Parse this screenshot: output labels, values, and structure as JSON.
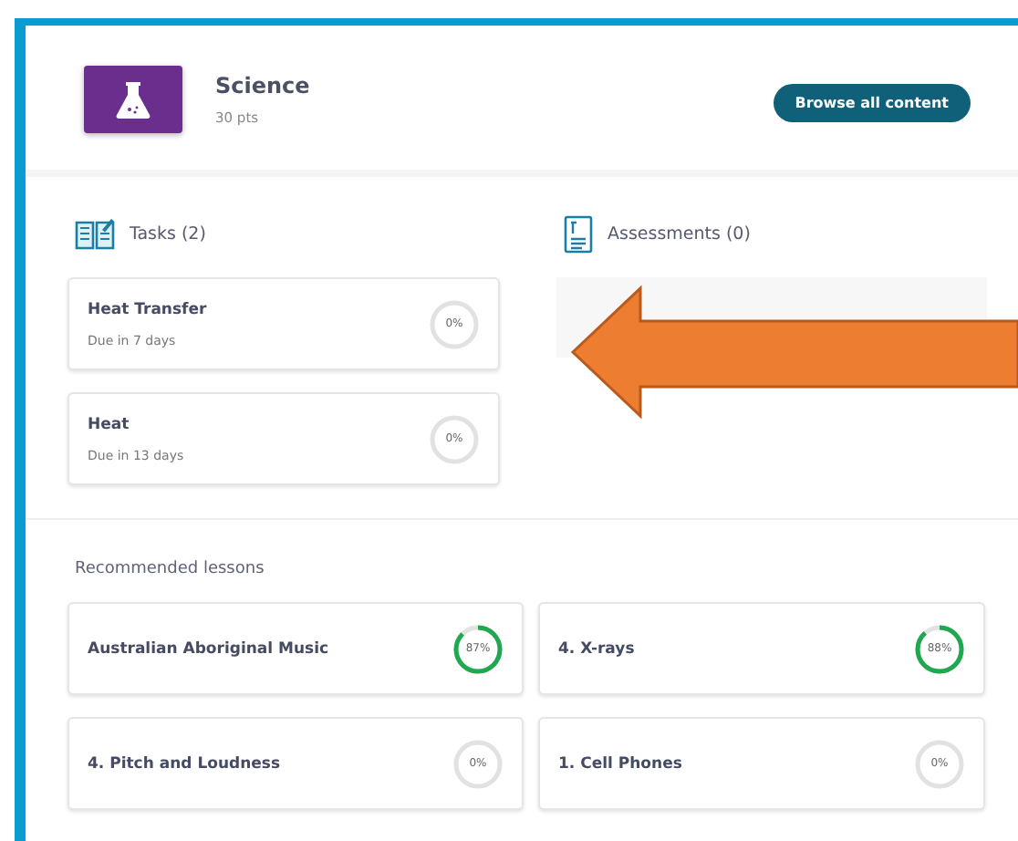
{
  "course": {
    "title": "Science",
    "points": "30 pts"
  },
  "browse_button": "Browse all content",
  "tasks": {
    "heading": "Tasks (2)",
    "items": [
      {
        "title": "Heat Transfer",
        "due": "Due in 7 days",
        "progress": "0%",
        "level": 0
      },
      {
        "title": "Heat",
        "due": "Due in 13 days",
        "progress": "0%",
        "level": 0
      }
    ]
  },
  "assessments": {
    "heading": "Assessments (0)"
  },
  "recommended": {
    "heading": "Recommended lessons",
    "items": [
      {
        "title": "Australian Aboriginal Music",
        "progress": "87%",
        "level": 0.87
      },
      {
        "title": "4. X-rays",
        "progress": "88%",
        "level": 0.88
      },
      {
        "title": "4. Pitch and Loudness",
        "progress": "0%",
        "level": 0
      },
      {
        "title": "1. Cell Phones",
        "progress": "0%",
        "level": 0
      }
    ]
  }
}
